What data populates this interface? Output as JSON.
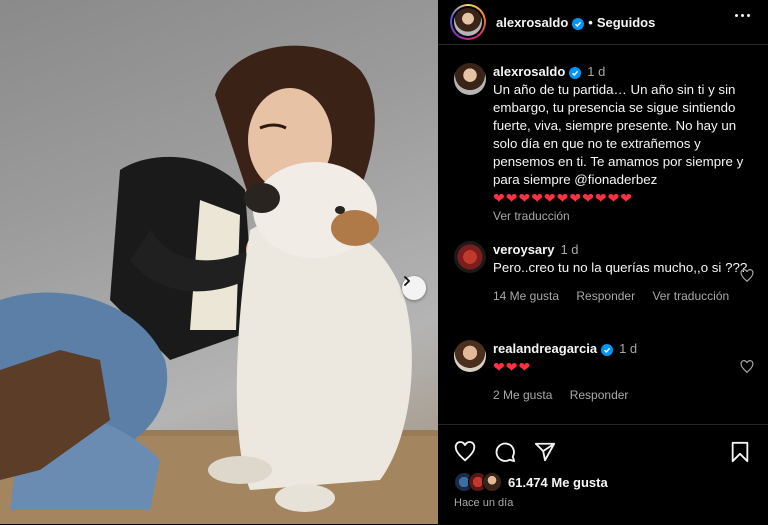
{
  "post": {
    "author": "alexrosaldo",
    "follow_status": "Seguidos",
    "dot": "•"
  },
  "caption": {
    "author": "alexrosaldo",
    "time": "1 d",
    "text": "Un año de tu partida… Un año sin ti y sin embargo, tu presencia se sigue sintiendo fuerte, viva, siempre presente. No hay un solo día en que no te extrañemos y pensemos en ti. Te amamos por siempre y para siempre @fionaderbez",
    "hearts": "❤❤❤❤❤❤❤❤❤❤❤",
    "translate": "Ver traducción"
  },
  "comments": [
    {
      "author": "veroysary",
      "time": "1 d",
      "text": "Pero..creo tu no la querías mucho,,o si ???",
      "likes": "14 Me gusta",
      "reply": "Responder",
      "translate": "Ver traducción"
    },
    {
      "author": "realandreagarcia",
      "time": "1 d",
      "hearts": "❤❤❤",
      "likes": "2 Me gusta",
      "reply": "Responder"
    }
  ],
  "footer": {
    "likes": "61.474 Me gusta",
    "posted": "Hace un día"
  },
  "colors": {
    "verified": "#0095f6",
    "heart": "#ff3040",
    "muted": "#a8a8a8"
  },
  "icons": [
    "heart-icon",
    "comment-icon",
    "share-icon",
    "bookmark-icon",
    "more-options-icon",
    "verified-icon",
    "chevron-right-icon"
  ]
}
